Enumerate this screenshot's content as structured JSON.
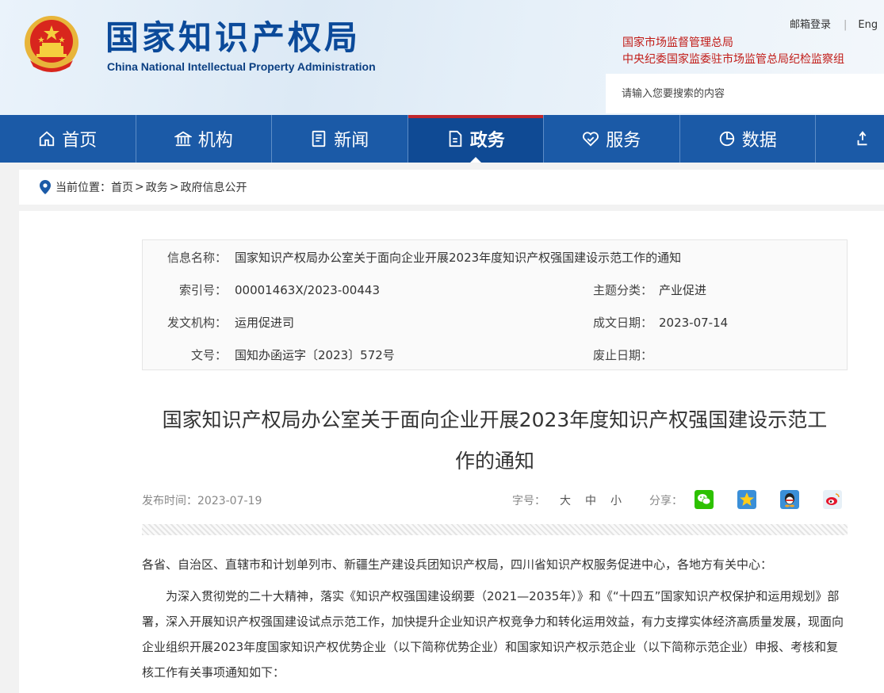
{
  "header": {
    "site_title": "国家知识产权局",
    "site_subtitle": "China National Intellectual Property Administration",
    "top_links": {
      "mail_login": "邮箱登录",
      "english": "Eng"
    },
    "org_links": [
      "国家市场监督管理总局",
      "中央纪委国家监委驻市场监管总局纪检监察组"
    ],
    "search_placeholder": "请输入您要搜索的内容"
  },
  "nav": {
    "items": [
      {
        "label": "首页",
        "icon": "home-icon"
      },
      {
        "label": "机构",
        "icon": "institution-icon"
      },
      {
        "label": "新闻",
        "icon": "news-icon"
      },
      {
        "label": "政务",
        "icon": "government-affairs-icon",
        "active": true
      },
      {
        "label": "服务",
        "icon": "service-icon"
      },
      {
        "label": "数据",
        "icon": "data-icon"
      },
      {
        "label": "",
        "icon": "interaction-icon"
      }
    ]
  },
  "breadcrumb": {
    "prefix": "当前位置：",
    "items": [
      "首页",
      "政务",
      "政府信息公开"
    ],
    "separator": ">"
  },
  "info": {
    "name_label": "信息名称：",
    "name_value": "国家知识产权局办公室关于面向企业开展2023年度知识产权强国建设示范工作的通知",
    "index_label": "索引号：",
    "index_value": "00001463X/2023-00443",
    "topic_label": "主题分类：",
    "topic_value": "产业促进",
    "issuer_label": "发文机构：",
    "issuer_value": "运用促进司",
    "date_label": "成文日期：",
    "date_value": "2023-07-14",
    "docno_label": "文号：",
    "docno_value": "国知办函运字〔2023〕572号",
    "expire_label": "废止日期：",
    "expire_value": ""
  },
  "article": {
    "title_line1": "国家知识产权局办公室关于面向企业开展2023年度知识产权强国建设示范工",
    "title_line2": "作的通知",
    "publish_label": "发布时间：",
    "publish_date": "2023-07-19",
    "font_size_label": "字号：",
    "font_sizes": [
      "大",
      "中",
      "小"
    ],
    "share_label": "分享：",
    "share_targets": [
      "wechat-icon",
      "qzone-icon",
      "qq-icon",
      "weibo-icon"
    ],
    "paragraph1": "各省、自治区、直辖市和计划单列市、新疆生产建设兵团知识产权局，四川省知识产权服务促进中心，各地方有关中心：",
    "paragraph2": "为深入贯彻党的二十大精神，落实《知识产权强国建设纲要（2021—2035年）》和《“十四五”国家知识产权保护和运用规划》部署，深入开展知识产权强国建设试点示范工作，加快提升企业知识产权竞争力和转化运用效益，有力支撑实体经济高质量发展，现面向企业组织开展2023年度国家知识产权优势企业（以下简称优势企业）和国家知识产权示范企业（以下简称示范企业）申报、考核和复核工作有关事项通知如下："
  },
  "colors": {
    "nav_bg": "#1b5aa7",
    "nav_active_bg": "#0f4a94",
    "accent_red": "#c1272d",
    "title_blue": "#0b4a9a"
  }
}
